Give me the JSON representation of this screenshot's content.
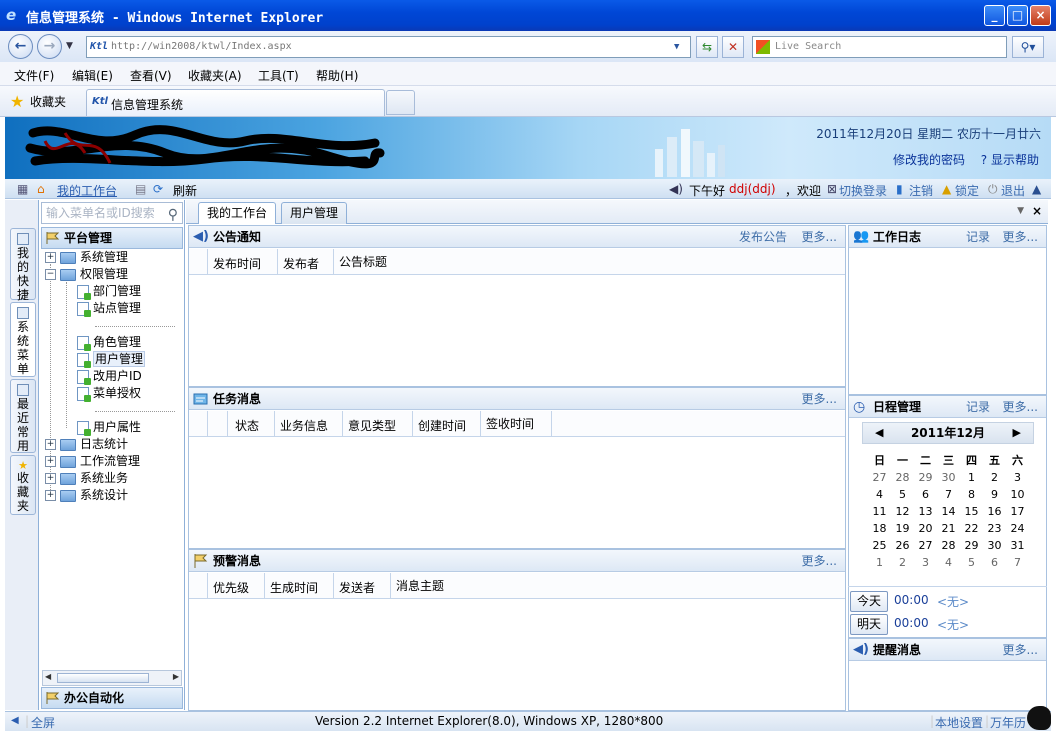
{
  "browser": {
    "title": "信息管理系统 - Windows Internet Explorer",
    "address": "http://win2008/ktwl/Index.aspx",
    "search_placeholder": "Live Search",
    "menu": [
      "文件(F)",
      "编辑(E)",
      "查看(V)",
      "收藏夹(A)",
      "工具(T)",
      "帮助(H)"
    ],
    "favorites_label": "收藏夹",
    "tab_title": "信息管理系统"
  },
  "banner": {
    "date": "2011年12月20日 星期二 农历十一月廿六",
    "change_password": "修改我的密码",
    "show_help": "显示帮助"
  },
  "toolbar": {
    "my_workbench": "我的工作台",
    "refresh": "刷新",
    "greeting": "下午好",
    "user": "ddj(ddj)",
    "welcome": "，欢迎",
    "switch_login": "切换登录",
    "logout": "注销",
    "lock": "锁定",
    "exit": "退出"
  },
  "side_tabs": [
    "我的快捷",
    "系统菜单",
    "最近常用",
    "收藏夹"
  ],
  "menu_panel": {
    "search_placeholder": "输入菜单名或ID搜索",
    "header": "平台管理",
    "footer": "办公自动化",
    "tree": {
      "system_mgmt": "系统管理",
      "permission_mgmt": "权限管理",
      "dept_mgmt": "部门管理",
      "site_mgmt": "站点管理",
      "role_mgmt": "角色管理",
      "user_mgmt": "用户管理",
      "change_user_id": "改用户ID",
      "menu_auth": "菜单授权",
      "user_attr": "用户属性",
      "log_stats": "日志统计",
      "workflow_mgmt": "工作流管理",
      "system_business": "系统业务",
      "system_design": "系统设计"
    }
  },
  "main_tabs": [
    "我的工作台",
    "用户管理"
  ],
  "notices": {
    "title": "公告通知",
    "publish": "发布公告",
    "more": "更多...",
    "columns": [
      "发布时间",
      "发布者",
      "公告标题"
    ]
  },
  "tasks": {
    "title": "任务消息",
    "more": "更多...",
    "columns": [
      "状态",
      "业务信息",
      "意见类型",
      "创建时间",
      "签收时间"
    ]
  },
  "alerts": {
    "title": "预警消息",
    "more": "更多...",
    "columns": [
      "优先级",
      "生成时间",
      "发送者",
      "消息主题"
    ]
  },
  "work_log": {
    "title": "工作日志",
    "record": "记录",
    "more": "更多..."
  },
  "schedule": {
    "title": "日程管理",
    "record": "记录",
    "more": "更多...",
    "month_label": "2011年12月",
    "weekdays": [
      "日",
      "一",
      "二",
      "三",
      "四",
      "五",
      "六"
    ],
    "days": [
      [
        "27",
        "28",
        "29",
        "30",
        "1",
        "2",
        "3"
      ],
      [
        "4",
        "5",
        "6",
        "7",
        "8",
        "9",
        "10"
      ],
      [
        "11",
        "12",
        "13",
        "14",
        "15",
        "16",
        "17"
      ],
      [
        "18",
        "19",
        "20",
        "21",
        "22",
        "23",
        "24"
      ],
      [
        "25",
        "26",
        "27",
        "28",
        "29",
        "30",
        "31"
      ],
      [
        "1",
        "2",
        "3",
        "4",
        "5",
        "6",
        "7"
      ]
    ],
    "today_btn": "今天",
    "tomorrow_btn": "明天",
    "time": "00:00",
    "none": "<无>"
  },
  "reminders": {
    "title": "提醒消息",
    "more": "更多..."
  },
  "status": {
    "fullscreen": "全屏",
    "version": "Version 2.2 Internet Explorer(8.0), Windows XP, 1280*800",
    "local_settings": "本地设置",
    "calendar_link": "万年历"
  }
}
